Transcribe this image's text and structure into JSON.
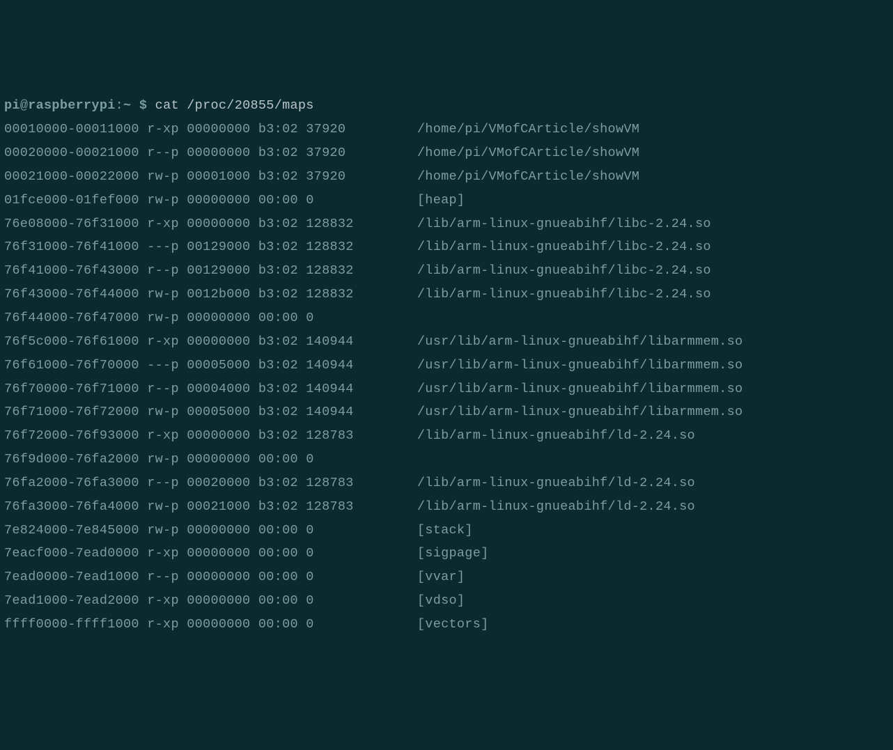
{
  "prompt": {
    "user": "pi",
    "at": "@",
    "host": "raspberrypi",
    "colon": ":",
    "path": "~",
    "dollar": " $ ",
    "command": "cat /proc/20855/maps"
  },
  "maps": [
    {
      "addr": "00010000-00011000",
      "perms": "r-xp",
      "offset": "00000000",
      "dev": "b3:02",
      "inode": "37920",
      "pathname": "/home/pi/VMofCArticle/showVM"
    },
    {
      "addr": "00020000-00021000",
      "perms": "r--p",
      "offset": "00000000",
      "dev": "b3:02",
      "inode": "37920",
      "pathname": "/home/pi/VMofCArticle/showVM"
    },
    {
      "addr": "00021000-00022000",
      "perms": "rw-p",
      "offset": "00001000",
      "dev": "b3:02",
      "inode": "37920",
      "pathname": "/home/pi/VMofCArticle/showVM"
    },
    {
      "addr": "01fce000-01fef000",
      "perms": "rw-p",
      "offset": "00000000",
      "dev": "00:00",
      "inode": "0",
      "pathname": "[heap]"
    },
    {
      "addr": "76e08000-76f31000",
      "perms": "r-xp",
      "offset": "00000000",
      "dev": "b3:02",
      "inode": "128832",
      "pathname": "/lib/arm-linux-gnueabihf/libc-2.24.so"
    },
    {
      "addr": "76f31000-76f41000",
      "perms": "---p",
      "offset": "00129000",
      "dev": "b3:02",
      "inode": "128832",
      "pathname": "/lib/arm-linux-gnueabihf/libc-2.24.so"
    },
    {
      "addr": "76f41000-76f43000",
      "perms": "r--p",
      "offset": "00129000",
      "dev": "b3:02",
      "inode": "128832",
      "pathname": "/lib/arm-linux-gnueabihf/libc-2.24.so"
    },
    {
      "addr": "76f43000-76f44000",
      "perms": "rw-p",
      "offset": "0012b000",
      "dev": "b3:02",
      "inode": "128832",
      "pathname": "/lib/arm-linux-gnueabihf/libc-2.24.so"
    },
    {
      "addr": "76f44000-76f47000",
      "perms": "rw-p",
      "offset": "00000000",
      "dev": "00:00",
      "inode": "0",
      "pathname": ""
    },
    {
      "addr": "76f5c000-76f61000",
      "perms": "r-xp",
      "offset": "00000000",
      "dev": "b3:02",
      "inode": "140944",
      "pathname": "/usr/lib/arm-linux-gnueabihf/libarmmem.so"
    },
    {
      "addr": "76f61000-76f70000",
      "perms": "---p",
      "offset": "00005000",
      "dev": "b3:02",
      "inode": "140944",
      "pathname": "/usr/lib/arm-linux-gnueabihf/libarmmem.so"
    },
    {
      "addr": "76f70000-76f71000",
      "perms": "r--p",
      "offset": "00004000",
      "dev": "b3:02",
      "inode": "140944",
      "pathname": "/usr/lib/arm-linux-gnueabihf/libarmmem.so"
    },
    {
      "addr": "76f71000-76f72000",
      "perms": "rw-p",
      "offset": "00005000",
      "dev": "b3:02",
      "inode": "140944",
      "pathname": "/usr/lib/arm-linux-gnueabihf/libarmmem.so"
    },
    {
      "addr": "76f72000-76f93000",
      "perms": "r-xp",
      "offset": "00000000",
      "dev": "b3:02",
      "inode": "128783",
      "pathname": "/lib/arm-linux-gnueabihf/ld-2.24.so"
    },
    {
      "addr": "76f9d000-76fa2000",
      "perms": "rw-p",
      "offset": "00000000",
      "dev": "00:00",
      "inode": "0",
      "pathname": ""
    },
    {
      "addr": "76fa2000-76fa3000",
      "perms": "r--p",
      "offset": "00020000",
      "dev": "b3:02",
      "inode": "128783",
      "pathname": "/lib/arm-linux-gnueabihf/ld-2.24.so"
    },
    {
      "addr": "76fa3000-76fa4000",
      "perms": "rw-p",
      "offset": "00021000",
      "dev": "b3:02",
      "inode": "128783",
      "pathname": "/lib/arm-linux-gnueabihf/ld-2.24.so"
    },
    {
      "addr": "7e824000-7e845000",
      "perms": "rw-p",
      "offset": "00000000",
      "dev": "00:00",
      "inode": "0",
      "pathname": "[stack]"
    },
    {
      "addr": "7eacf000-7ead0000",
      "perms": "r-xp",
      "offset": "00000000",
      "dev": "00:00",
      "inode": "0",
      "pathname": "[sigpage]"
    },
    {
      "addr": "7ead0000-7ead1000",
      "perms": "r--p",
      "offset": "00000000",
      "dev": "00:00",
      "inode": "0",
      "pathname": "[vvar]"
    },
    {
      "addr": "7ead1000-7ead2000",
      "perms": "r-xp",
      "offset": "00000000",
      "dev": "00:00",
      "inode": "0",
      "pathname": "[vdso]"
    },
    {
      "addr": "ffff0000-ffff1000",
      "perms": "r-xp",
      "offset": "00000000",
      "dev": "00:00",
      "inode": "0",
      "pathname": "[vectors]"
    }
  ]
}
